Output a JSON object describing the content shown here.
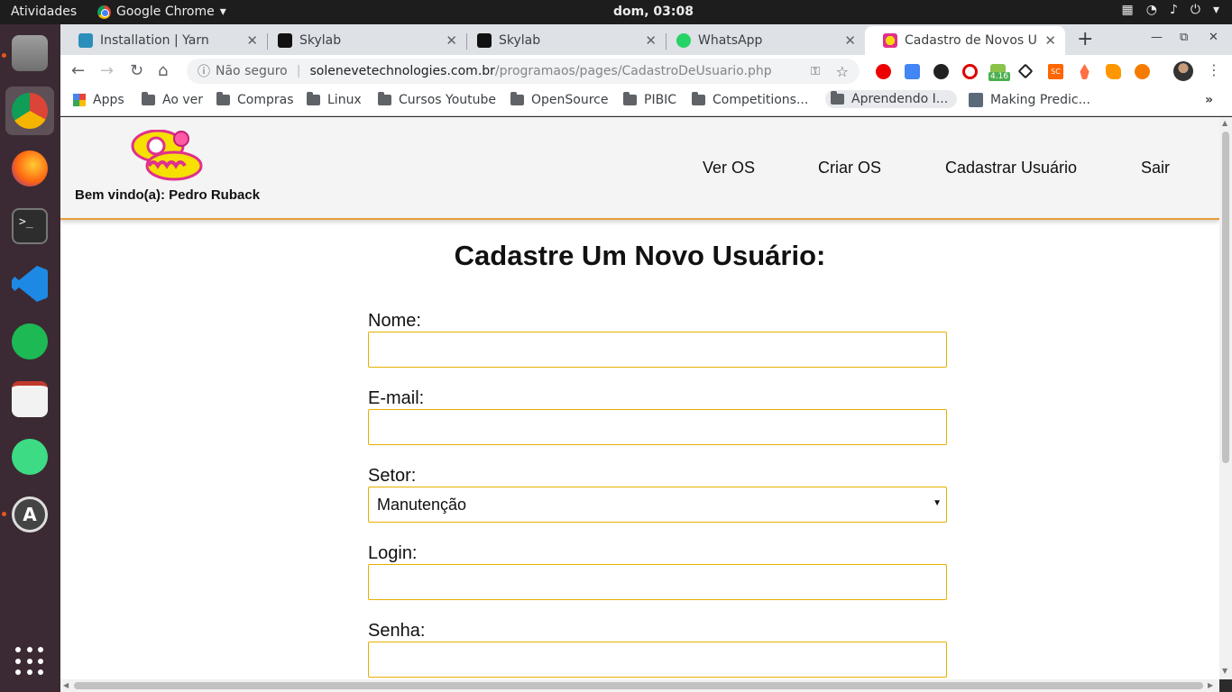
{
  "system": {
    "activities": "Atividades",
    "app_name": "Google Chrome",
    "clock": "dom, 03:08"
  },
  "tabs": [
    {
      "title": "Installation | Yarn",
      "active": false
    },
    {
      "title": "Skylab",
      "active": false
    },
    {
      "title": "Skylab",
      "active": false
    },
    {
      "title": "WhatsApp",
      "active": false
    },
    {
      "title": "Cadastro de Novos Usu",
      "active": true
    }
  ],
  "address_bar": {
    "security": "Não seguro",
    "domain": "solenevetechnologies.com.br",
    "path": "/programaos/pages/CadastroDeUsuario.php"
  },
  "extensions": {
    "badge": "4.16",
    "sc_label": "SC"
  },
  "bookmarks": [
    "Apps",
    "Ao ver",
    "Compras",
    "Linux",
    "Cursos Youtube",
    "OpenSource",
    "PIBIC",
    "Competitions...",
    "Aprendendo I...",
    "Making Predic..."
  ],
  "site": {
    "welcome": "Bem vindo(a): Pedro Ruback",
    "nav": [
      "Ver OS",
      "Criar OS",
      "Cadastrar Usuário",
      "Sair"
    ]
  },
  "form": {
    "title": "Cadastre Um Novo Usuário:",
    "fields": [
      {
        "label": "Nome:",
        "value": ""
      },
      {
        "label": "E-mail:",
        "value": ""
      },
      {
        "label": "Setor:",
        "value": "Manutenção"
      },
      {
        "label": "Login:",
        "value": ""
      },
      {
        "label": "Senha:",
        "value": ""
      }
    ]
  },
  "colors": {
    "header_border": "#e69b38",
    "input_border": "#e5b000",
    "dock_bg": "#3b2a33"
  }
}
